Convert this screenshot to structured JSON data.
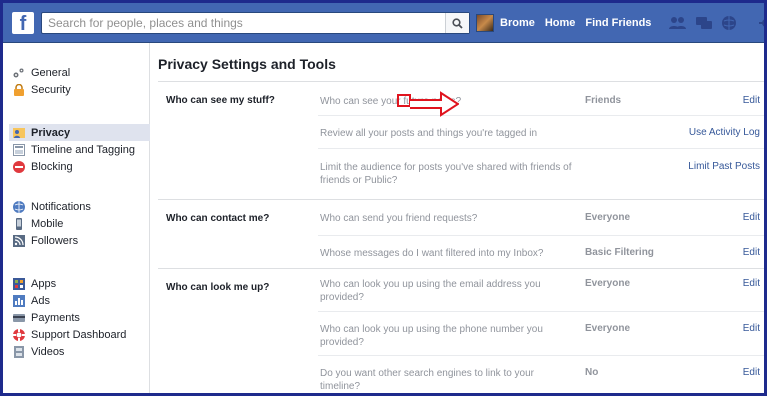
{
  "search": {
    "placeholder": "Search for people, places and things"
  },
  "nav": {
    "user": "Brome",
    "home": "Home",
    "find_friends": "Find Friends"
  },
  "sidebar": {
    "groups": [
      [
        {
          "label": "General",
          "icon": "gear-icon"
        },
        {
          "label": "Security",
          "icon": "lock-icon"
        }
      ],
      [
        {
          "label": "Privacy",
          "icon": "privacy-icon",
          "active": true
        },
        {
          "label": "Timeline and Tagging",
          "icon": "timeline-icon"
        },
        {
          "label": "Blocking",
          "icon": "block-icon"
        }
      ],
      [
        {
          "label": "Notifications",
          "icon": "globe-icon"
        },
        {
          "label": "Mobile",
          "icon": "mobile-icon"
        },
        {
          "label": "Followers",
          "icon": "rss-icon"
        }
      ],
      [
        {
          "label": "Apps",
          "icon": "apps-icon"
        },
        {
          "label": "Ads",
          "icon": "ads-icon"
        },
        {
          "label": "Payments",
          "icon": "card-icon"
        },
        {
          "label": "Support Dashboard",
          "icon": "lifebuoy-icon"
        },
        {
          "label": "Videos",
          "icon": "film-icon"
        }
      ]
    ]
  },
  "main": {
    "title": "Privacy Settings and Tools",
    "sections": [
      {
        "label": "Who can see my stuff?",
        "rows": [
          {
            "question": "Who can see your future posts?",
            "value": "Friends",
            "action": "Edit"
          },
          {
            "question": "Review all your posts and things you're tagged in",
            "value": "",
            "action": "Use Activity Log"
          },
          {
            "question": "Limit the audience for posts you've shared with friends of friends or Public?",
            "value": "",
            "action": "Limit Past Posts"
          }
        ]
      },
      {
        "label": "Who can contact me?",
        "rows": [
          {
            "question": "Who can send you friend requests?",
            "value": "Everyone",
            "action": "Edit"
          },
          {
            "question": "Whose messages do I want filtered into my Inbox?",
            "value": "Basic Filtering",
            "action": "Edit"
          }
        ]
      },
      {
        "label": "Who can look me up?",
        "rows": [
          {
            "question": "Who can look you up using the email address you provided?",
            "value": "Everyone",
            "action": "Edit"
          },
          {
            "question": "Who can look you up using the phone number you provided?",
            "value": "Everyone",
            "action": "Edit"
          },
          {
            "question": "Do you want other search engines to link to your timeline?",
            "value": "No",
            "action": "Edit"
          }
        ]
      }
    ]
  },
  "colors": {
    "brand": "#4267b2",
    "link": "#365899",
    "annotation": "#e0141e"
  }
}
